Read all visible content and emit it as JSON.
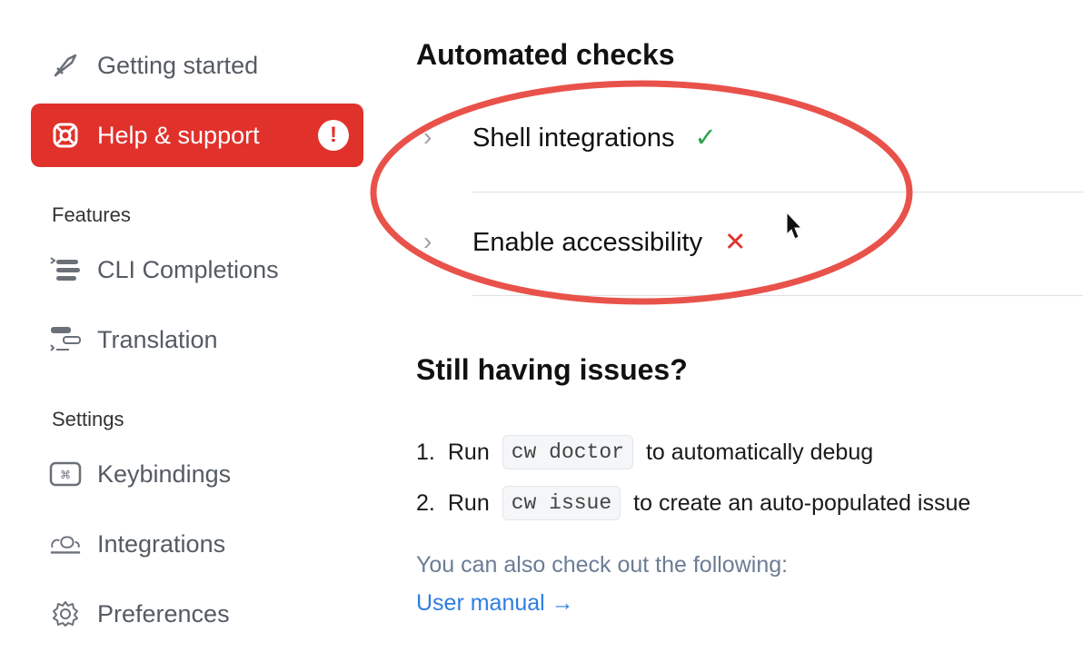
{
  "sidebar": {
    "items_top": [
      {
        "label": "Getting started",
        "icon": "rocket-icon"
      },
      {
        "label": "Help & support",
        "icon": "lifebuoy-icon",
        "badge": "!"
      }
    ],
    "features": {
      "heading": "Features",
      "items": [
        {
          "label": "CLI Completions",
          "icon": "cli-completions-icon"
        },
        {
          "label": "Translation",
          "icon": "translation-icon"
        }
      ]
    },
    "settings": {
      "heading": "Settings",
      "items": [
        {
          "label": "Keybindings",
          "icon": "keyboard-icon"
        },
        {
          "label": "Integrations",
          "icon": "integrations-icon"
        },
        {
          "label": "Preferences",
          "icon": "gear-icon"
        }
      ]
    }
  },
  "main": {
    "automated_checks": {
      "title": "Automated checks",
      "checks": [
        {
          "label": "Shell integrations",
          "status": "pass",
          "status_glyph": "✓",
          "status_color": "#2ea44f"
        },
        {
          "label": "Enable accessibility",
          "status": "fail",
          "status_glyph": "✕",
          "status_color": "#e0312b"
        }
      ]
    },
    "issues": {
      "title": "Still having issues?",
      "steps": [
        {
          "num": "1.",
          "run": "Run",
          "command": "cw doctor",
          "text": "to automatically debug"
        },
        {
          "num": "2.",
          "run": "Run",
          "command": "cw issue",
          "text": "to create an auto-populated issue"
        }
      ],
      "more_text": "You can also check out the following:",
      "link": "User manual →"
    }
  },
  "colors": {
    "accent": "#e0312b",
    "annotation": "#e8524a",
    "link": "#2f7de1"
  }
}
